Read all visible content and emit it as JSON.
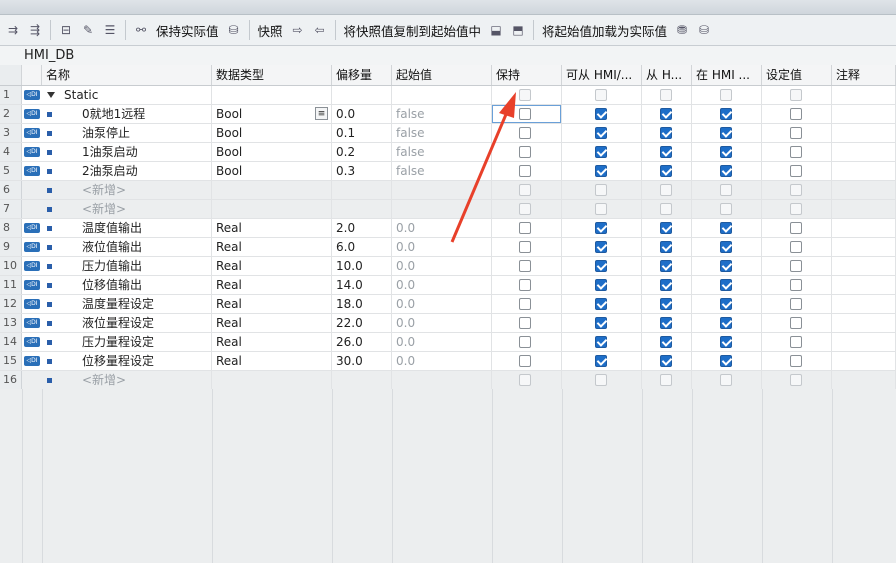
{
  "toolbar": {
    "keep_actual": "保持实际值",
    "snapshot": "快照",
    "copy_snapshot": "将快照值复制到起始值中",
    "load_start": "将起始值加载为实际值"
  },
  "db": {
    "title": "HMI_DB"
  },
  "columns": [
    "名称",
    "数据类型",
    "偏移量",
    "起始值",
    "保持",
    "可从 HMI/...",
    "从 H...",
    "在 HMI ...",
    "设定值",
    "注释"
  ],
  "rows": [
    {
      "num": "1",
      "name": "Static",
      "type": "",
      "offset": "",
      "start": "",
      "retain": false,
      "hmi1": false,
      "hmi2": false,
      "hmi3": false,
      "set": false,
      "kind": "struct"
    },
    {
      "num": "2",
      "name": "0就地1远程",
      "type": "Bool",
      "offset": "0.0",
      "start": "false",
      "retain": false,
      "hmi1": true,
      "hmi2": true,
      "hmi3": true,
      "set": false,
      "kind": "var"
    },
    {
      "num": "3",
      "name": "油泵停止",
      "type": "Bool",
      "offset": "0.1",
      "start": "false",
      "retain": false,
      "hmi1": true,
      "hmi2": true,
      "hmi3": true,
      "set": false,
      "kind": "var"
    },
    {
      "num": "4",
      "name": "1油泵启动",
      "type": "Bool",
      "offset": "0.2",
      "start": "false",
      "retain": false,
      "hmi1": true,
      "hmi2": true,
      "hmi3": true,
      "set": false,
      "kind": "var"
    },
    {
      "num": "5",
      "name": "2油泵启动",
      "type": "Bool",
      "offset": "0.3",
      "start": "false",
      "retain": false,
      "hmi1": true,
      "hmi2": true,
      "hmi3": true,
      "set": false,
      "kind": "var"
    },
    {
      "num": "6",
      "name": "<新增>",
      "type": "",
      "offset": "",
      "start": "",
      "retain": false,
      "hmi1": false,
      "hmi2": false,
      "hmi3": false,
      "set": false,
      "kind": "new"
    },
    {
      "num": "7",
      "name": "<新增>",
      "type": "",
      "offset": "",
      "start": "",
      "retain": false,
      "hmi1": false,
      "hmi2": false,
      "hmi3": false,
      "set": false,
      "kind": "new"
    },
    {
      "num": "8",
      "name": "温度值输出",
      "type": "Real",
      "offset": "2.0",
      "start": "0.0",
      "retain": false,
      "hmi1": true,
      "hmi2": true,
      "hmi3": true,
      "set": false,
      "kind": "var"
    },
    {
      "num": "9",
      "name": "液位值输出",
      "type": "Real",
      "offset": "6.0",
      "start": "0.0",
      "retain": false,
      "hmi1": true,
      "hmi2": true,
      "hmi3": true,
      "set": false,
      "kind": "var"
    },
    {
      "num": "10",
      "name": "压力值输出",
      "type": "Real",
      "offset": "10.0",
      "start": "0.0",
      "retain": false,
      "hmi1": true,
      "hmi2": true,
      "hmi3": true,
      "set": false,
      "kind": "var"
    },
    {
      "num": "11",
      "name": "位移值输出",
      "type": "Real",
      "offset": "14.0",
      "start": "0.0",
      "retain": false,
      "hmi1": true,
      "hmi2": true,
      "hmi3": true,
      "set": false,
      "kind": "var"
    },
    {
      "num": "12",
      "name": "温度量程设定",
      "type": "Real",
      "offset": "18.0",
      "start": "0.0",
      "retain": false,
      "hmi1": true,
      "hmi2": true,
      "hmi3": true,
      "set": false,
      "kind": "var"
    },
    {
      "num": "13",
      "name": "液位量程设定",
      "type": "Real",
      "offset": "22.0",
      "start": "0.0",
      "retain": false,
      "hmi1": true,
      "hmi2": true,
      "hmi3": true,
      "set": false,
      "kind": "var"
    },
    {
      "num": "14",
      "name": "压力量程设定",
      "type": "Real",
      "offset": "26.0",
      "start": "0.0",
      "retain": false,
      "hmi1": true,
      "hmi2": true,
      "hmi3": true,
      "set": false,
      "kind": "var"
    },
    {
      "num": "15",
      "name": "位移量程设定",
      "type": "Real",
      "offset": "30.0",
      "start": "0.0",
      "retain": false,
      "hmi1": true,
      "hmi2": true,
      "hmi3": true,
      "set": false,
      "kind": "var"
    },
    {
      "num": "16",
      "name": "<新增>",
      "type": "",
      "offset": "",
      "start": "",
      "retain": false,
      "hmi1": false,
      "hmi2": false,
      "hmi3": false,
      "set": false,
      "kind": "new"
    }
  ],
  "colors": {
    "checked": "#1e6ec8",
    "arrow": "#e8402a"
  }
}
